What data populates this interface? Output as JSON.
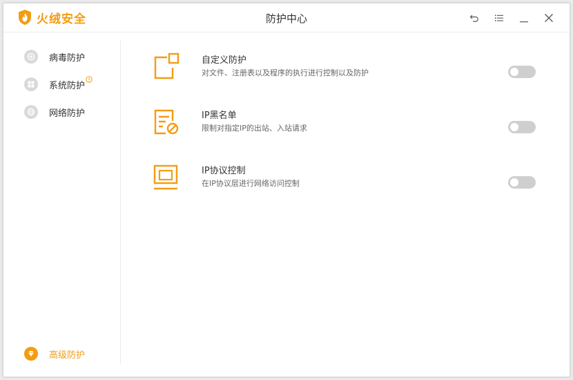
{
  "app": {
    "brand_name": "火绒安全",
    "window_title": "防护中心",
    "accent_color": "#f39c12"
  },
  "title_buttons": [
    {
      "name": "back-icon"
    },
    {
      "name": "menu-icon"
    },
    {
      "name": "minimize-icon"
    },
    {
      "name": "close-icon"
    }
  ],
  "sidebar": {
    "items": [
      {
        "label": "病毒防护",
        "icon": "virus-shield-icon"
      },
      {
        "label": "系统防护",
        "icon": "windows-icon",
        "badge": "!"
      },
      {
        "label": "网络防护",
        "icon": "globe-icon"
      }
    ],
    "premium": {
      "label": "高级防护",
      "icon": "diamond-icon"
    }
  },
  "features": [
    {
      "title": "自定义防护",
      "desc": "对文件、注册表以及程序的执行进行控制以及防护",
      "icon": "custom-protection-icon",
      "enabled": false
    },
    {
      "title": "IP黑名单",
      "desc": "限制对指定IP的出站、入站请求",
      "icon": "ip-blacklist-icon",
      "enabled": false
    },
    {
      "title": "IP协议控制",
      "desc": "在IP协议层进行网络访问控制",
      "icon": "ip-protocol-icon",
      "enabled": false
    }
  ]
}
